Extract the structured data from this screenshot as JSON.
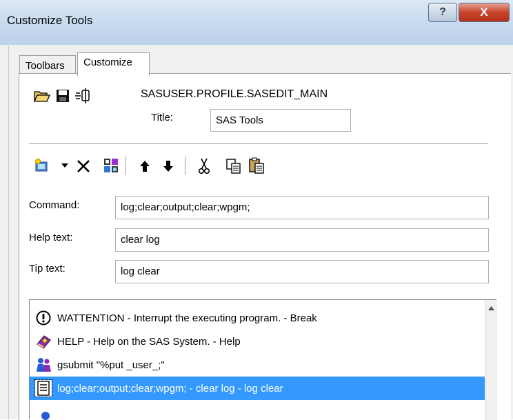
{
  "window": {
    "title": "Customize Tools",
    "help_glyph": "?",
    "close_glyph": "X"
  },
  "tabs": [
    {
      "label": "Toolbars"
    },
    {
      "label": "Customize"
    }
  ],
  "customize": {
    "catalog_path": "SASUSER.PROFILE.SASEDIT_MAIN",
    "title_label": "Title:",
    "title_value": "SAS Tools",
    "command_label": "Command:",
    "command_value": "log;clear;output;clear;wpgm;",
    "help_label": "Help text:",
    "help_value": "clear log",
    "tip_label": "Tip text:",
    "tip_value": "log clear"
  },
  "tools_list": [
    {
      "text": "WATTENTION - Interrupt the executing program. - Break",
      "icon": "attention-icon"
    },
    {
      "text": "HELP - Help on the SAS System. - Help",
      "icon": "help-book-icon"
    },
    {
      "text": "gsubmit \"%put _user_;\"",
      "icon": "users-icon"
    },
    {
      "text": "log;clear;output;clear;wpgm; - clear log - log clear",
      "icon": "document-icon",
      "selected": true
    }
  ],
  "colors": {
    "selection": "#3399ff",
    "titlebar": "#c4d8ee",
    "close_button": "#c7442b"
  }
}
